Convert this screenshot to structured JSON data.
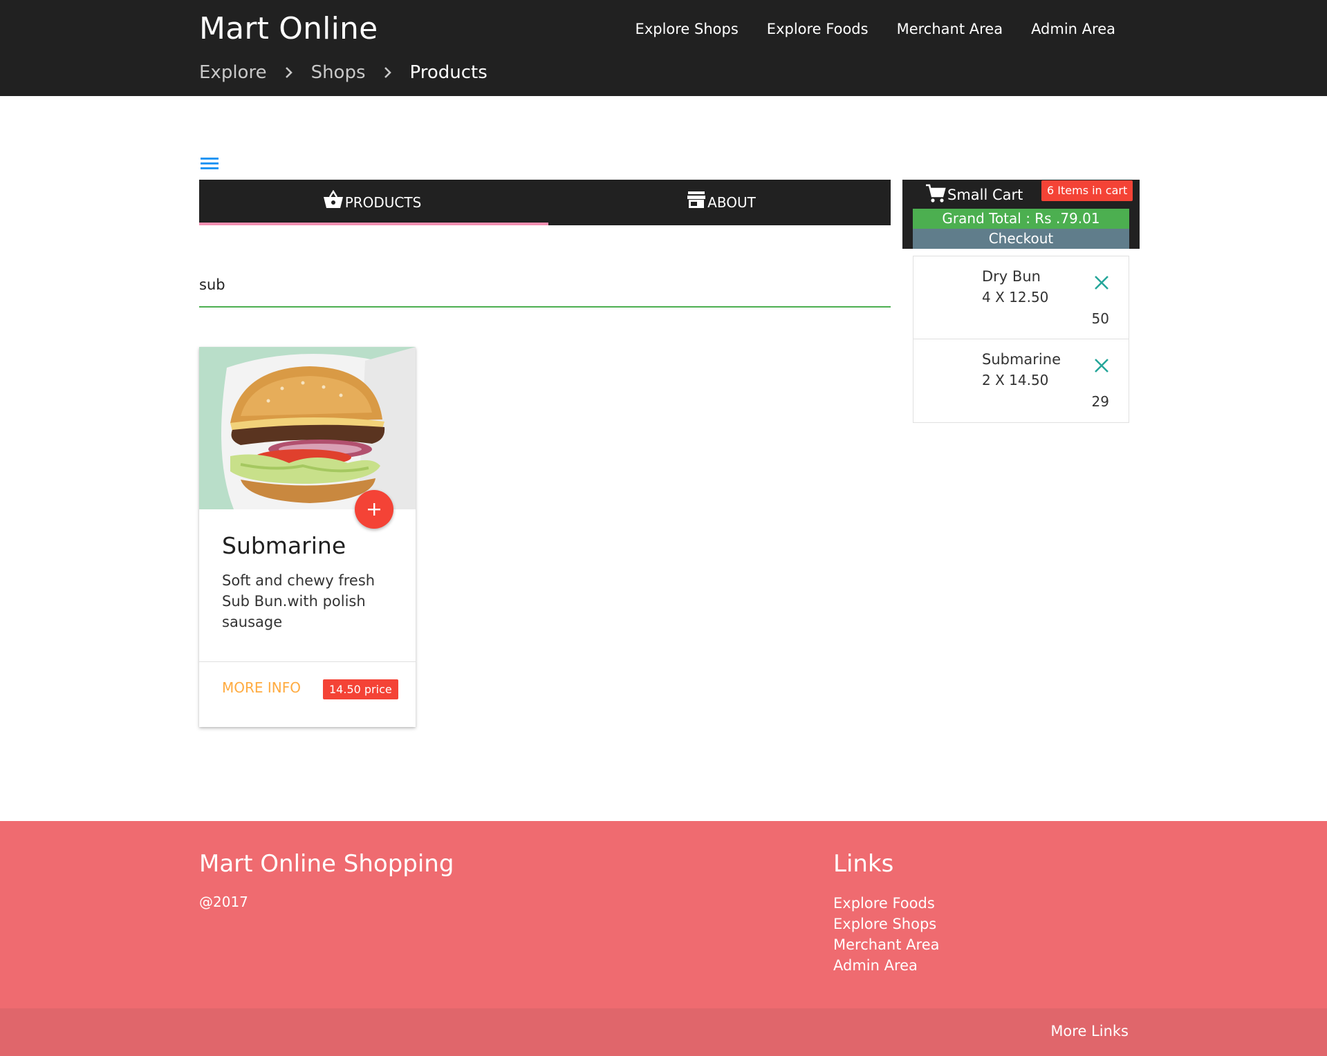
{
  "header": {
    "brand": "Mart Online",
    "nav": [
      "Explore Shops",
      "Explore Foods",
      "Merchant Area",
      "Admin Area"
    ],
    "breadcrumb": [
      "Explore",
      "Shops",
      "Products"
    ]
  },
  "tabs": {
    "products": "PRODUCTS",
    "about": "ABOUT"
  },
  "search": {
    "value": "sub"
  },
  "product": {
    "title": "Submarine",
    "description": "Soft and chewy fresh Sub Bun.with polish sausage",
    "more_info": "MORE INFO",
    "price": "14.50 price"
  },
  "cart": {
    "title": "Small Cart",
    "items_badge": "6 Items in cart",
    "grand_total": "Grand Total : Rs .79.01",
    "checkout": "Checkout",
    "items": [
      {
        "name": "Dry Bun",
        "qty": "4 X 12.50",
        "total": "50"
      },
      {
        "name": "Submarine",
        "qty": "2 X 14.50",
        "total": "29"
      }
    ]
  },
  "footer": {
    "title": "Mart Online Shopping",
    "copyright": "@2017",
    "links_title": "Links",
    "links": [
      "Explore Foods",
      "Explore Shops",
      "Merchant Area",
      "Admin Area"
    ],
    "more_links": "More Links"
  },
  "colors": {
    "navbar": "#212121",
    "accent_red": "#f44336",
    "green": "#4caf50",
    "footer": "#ef6b70"
  }
}
